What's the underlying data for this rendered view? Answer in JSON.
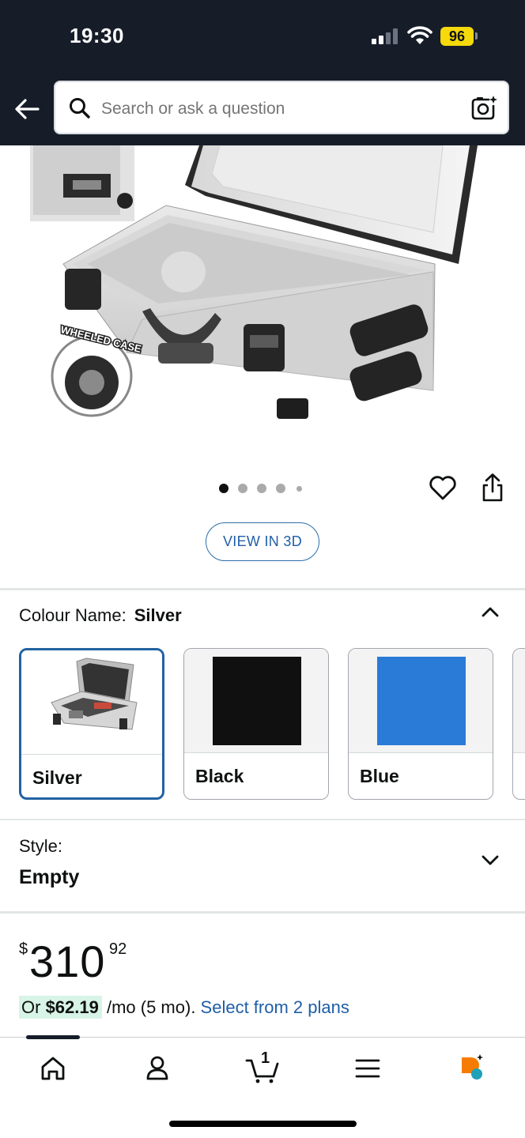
{
  "status_bar": {
    "time": "19:30",
    "battery": "96"
  },
  "header": {
    "search_placeholder": "Search or ask a question",
    "icons": [
      "back-arrow-icon",
      "search-icon",
      "camera-lens-icon"
    ]
  },
  "gallery": {
    "image_count": 5,
    "current_image": 1,
    "overlay_text": "WHEELED CASE",
    "view_3d_label": "VIEW IN 3D"
  },
  "colour": {
    "label": "Colour Name:",
    "selected": "Silver",
    "options": [
      {
        "label": "Silver",
        "swatch": "image",
        "selected": true
      },
      {
        "label": "Black",
        "swatch": "#111010",
        "selected": false
      },
      {
        "label": "Blue",
        "swatch": "#2a7bd8",
        "selected": false
      }
    ]
  },
  "style": {
    "label": "Style:",
    "value": "Empty"
  },
  "price": {
    "symbol": "$",
    "whole": "310",
    "fraction": "92",
    "monthly_prefix": "Or ",
    "monthly_amount": "$62.19",
    "monthly_suffix": " /mo (5 mo). ",
    "plans_link": "Select from 2 plans"
  },
  "bottom_nav": {
    "items": [
      "home-icon",
      "account-icon",
      "cart-icon",
      "menu-icon",
      "assistant-icon"
    ],
    "cart_count": "1",
    "active": "home-icon"
  },
  "colors": {
    "header_bg": "#161d29",
    "link": "#1f5ea8",
    "selected_border": "#2162a1",
    "highlight": "#d7f4e6",
    "assistant_orange": "#f57c00",
    "assistant_teal": "#1fa1b8"
  }
}
